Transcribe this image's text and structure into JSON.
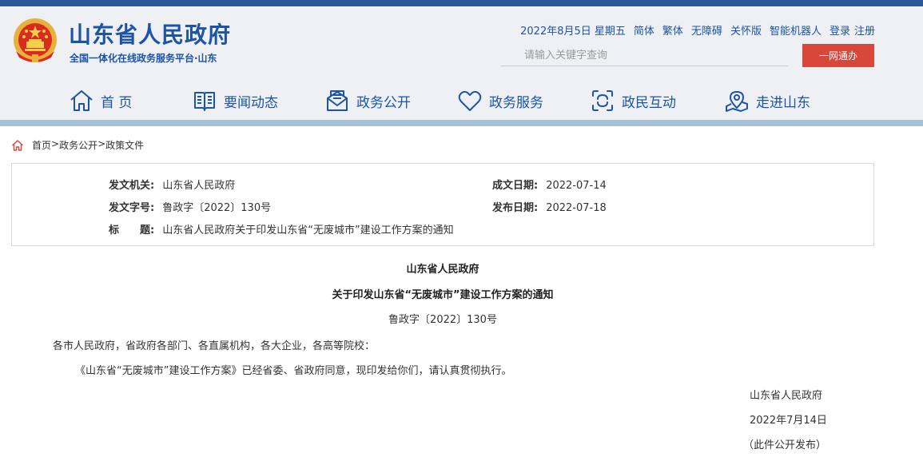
{
  "header": {
    "site_title": "山东省人民政府",
    "site_subtitle": "全国一体化在线政务服务平台·山东",
    "date": "2022年8月5日 星期五",
    "links": [
      "简体",
      "繁体",
      "无障碍",
      "关怀版",
      "智能机器人",
      "登录",
      "注册"
    ],
    "search_placeholder": "请输入关键字查询",
    "search_button": "一网通办",
    "colors": {
      "brand": "#1c54a6",
      "top_bar": "#2b5797",
      "bottom_bar": "#a9bfd8",
      "button": "#d9473b",
      "background": "#eef0f3"
    }
  },
  "nav": [
    {
      "label": "首 页",
      "icon": "home-icon"
    },
    {
      "label": "要闻动态",
      "icon": "news-book-icon"
    },
    {
      "label": "政务公开",
      "icon": "mail-open-icon"
    },
    {
      "label": "政务服务",
      "icon": "heart-icon"
    },
    {
      "label": "政民互动",
      "icon": "interaction-icon"
    },
    {
      "label": "走进山东",
      "icon": "location-pin-icon"
    }
  ],
  "breadcrumb": {
    "icon": "home-icon",
    "items": [
      "首页",
      "政务公开",
      "政策文件"
    ],
    "separator": ">"
  },
  "meta": {
    "issuer_label": "发文机关:",
    "issuer": "山东省人民政府",
    "created_label": "成文日期:",
    "created": "2022-07-14",
    "doc_no_label": "发文字号:",
    "doc_no": "鲁政字〔2022〕130号",
    "published_label": "发布日期:",
    "published": "2022-07-18",
    "title_label": "标　　题:",
    "title": "山东省人民政府关于印发山东省“无废城市”建设工作方案的通知"
  },
  "document": {
    "org": "山东省人民政府",
    "title": "关于印发山东省“无废城市”建设工作方案的通知",
    "number": "鲁政字〔2022〕130号",
    "salutation": "各市人民政府，省政府各部门、各直属机构，各大企业，各高等院校：",
    "paragraph": "《山东省“无废城市”建设工作方案》已经省委、省政府同意，现印发给你们，请认真贯彻执行。",
    "sign_org": "山东省人民政府",
    "sign_date": "2022年7月14日",
    "note": "（此件公开发布）"
  }
}
